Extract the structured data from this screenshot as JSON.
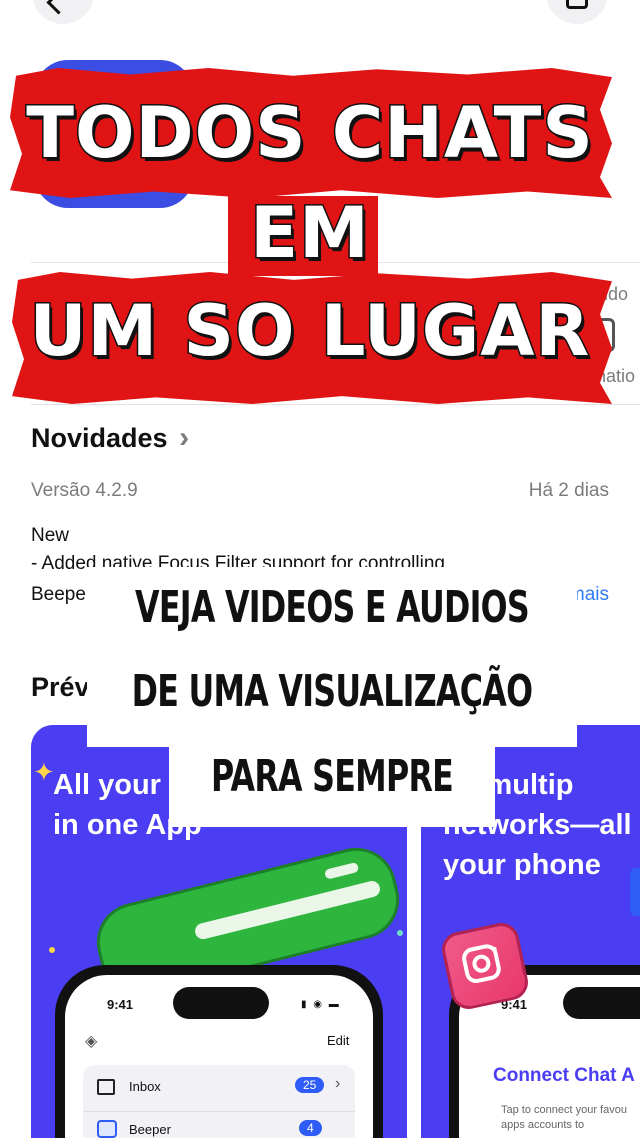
{
  "banner": {
    "line1": "TODOS CHATS",
    "line2": "EM",
    "line3": "UM SO LUGAR"
  },
  "right_edge_fragments": {
    "top": "ido",
    "bottom": "natio"
  },
  "whats_new": {
    "title": "Novidades",
    "chevron": "›",
    "version": "Versão 4.2.9",
    "date": "Há 2 dias",
    "notes_line1": "New",
    "notes_line2": "- Added native Focus Filter support for controlling",
    "notes_line3": "Beepe",
    "more_link": "mais"
  },
  "previews": {
    "title": "Prév",
    "shot1_text": "All your\nin one App",
    "shot2_text": "up multip\nnetworks—all\nyour phone",
    "phone1": {
      "time": "9:41",
      "edit": "Edit",
      "rows": [
        {
          "label": "Inbox",
          "count": "25"
        },
        {
          "label": "Beeper",
          "count": "4"
        }
      ]
    },
    "phone2": {
      "time": "9:41",
      "title": "Connect Chat A",
      "subtitle": "Tap to connect your favou\napps accounts to"
    }
  },
  "caption": {
    "line1": "VEJA VIDEOS E AUDIOS",
    "line2": "DE UMA VISUALIZAÇÃO",
    "line3": "PARA SEMPRE"
  },
  "colors": {
    "banner_red": "#e01414",
    "app_blue": "#3b4de3",
    "preview_purple": "#4a3df2",
    "link_blue": "#2f7cf6",
    "bubble_green": "#2db53d",
    "instagram_pink": "#e8386b"
  }
}
